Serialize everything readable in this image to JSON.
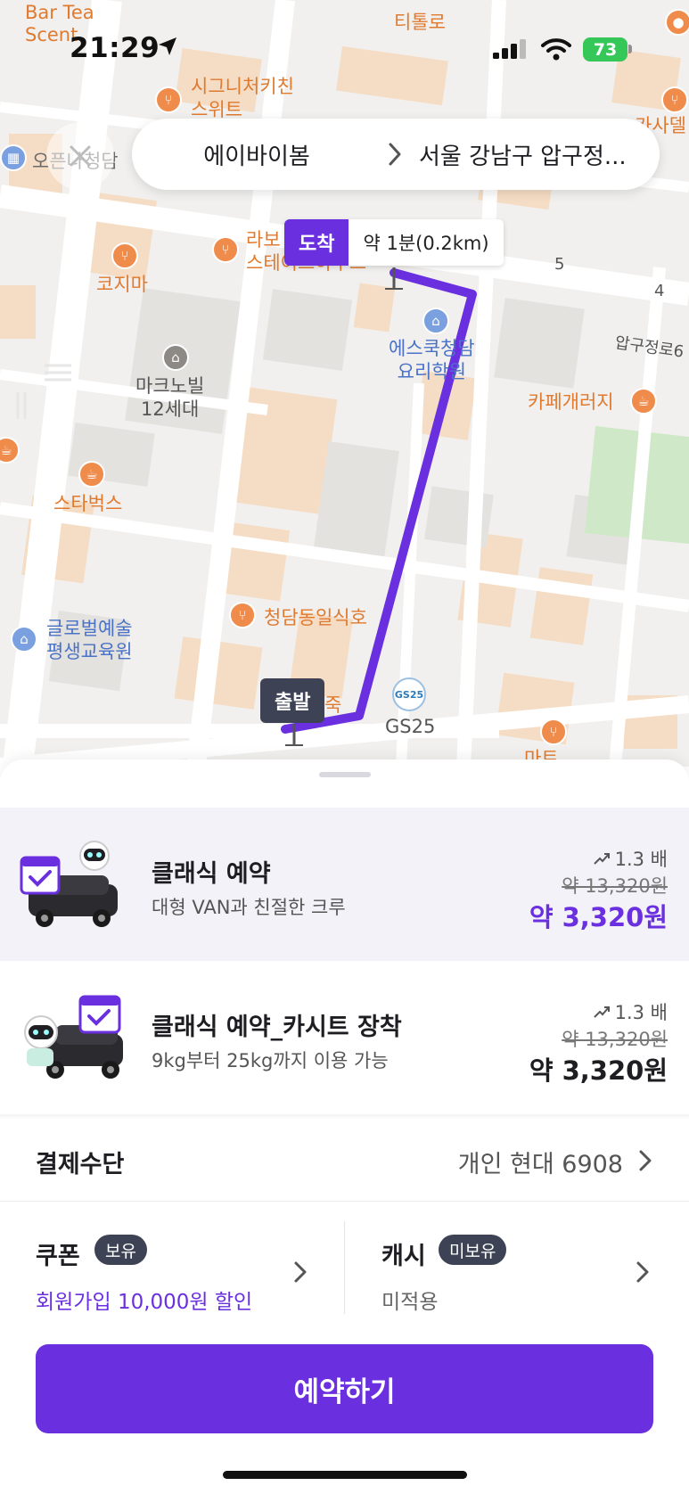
{
  "status_bar": {
    "time": "21:29",
    "battery": "73"
  },
  "map": {
    "labels": {
      "bar_tea_1": "Bar Tea",
      "bar_tea_2": "Scent",
      "teotollo": "티톨로",
      "signature_1": "시그니처키친",
      "signature_2": "스위트",
      "kasadel": "카사델",
      "opennet": "오픈나청담",
      "kojima": "코지마",
      "rabo_1": "라보",
      "rabo_2": "스테이크하우스",
      "num5": "5",
      "num4": "4",
      "apgujeong_ro": "압구정로6",
      "mark_1": "마크노빌",
      "mark_2": "12세대",
      "escook_1": "에스쿡청담",
      "escook_2": "요리학원",
      "cafe_gallery": "카페개러지",
      "starbucks": "스타벅스",
      "global_1": "글로벌예술",
      "global_2": "평생교육원",
      "cheongdam_il": "청담동일식호",
      "gs25": "GS25",
      "gs25_logo_1": "GS",
      "gs25_logo_2": "25",
      "juk": "죽",
      "mart": "마트"
    },
    "arrival": {
      "badge": "도착",
      "eta": "약 1분(0.2km)"
    },
    "departure": {
      "badge": "출발"
    },
    "route_color": "#6a2fdf"
  },
  "route_bar": {
    "origin": "에이바이봄",
    "destination": "서울 강남구 압구정..."
  },
  "services": [
    {
      "title": "클래식 예약",
      "description": "대형 VAN과 친절한 크루",
      "surge": "1.3 배",
      "original_price": "약 13,320원",
      "price": "약 3,320원",
      "selected": true
    },
    {
      "title": "클래식 예약_카시트 장착",
      "description": "9kg부터 25kg까지 이용 가능",
      "surge": "1.3 배",
      "original_price": "약 13,320원",
      "price": "약 3,320원",
      "selected": false
    }
  ],
  "payment": {
    "label": "결제수단",
    "value": "개인 현대 6908"
  },
  "coupon": {
    "label": "쿠폰",
    "badge": "보유",
    "sub": "회원가입 10,000원 할인"
  },
  "cash": {
    "label": "캐시",
    "badge": "미보유",
    "sub": "미적용"
  },
  "cta": {
    "label": "예약하기"
  },
  "colors": {
    "accent": "#6a2fdf",
    "badge_dark": "#3d4255",
    "selected_bg": "#f3f2f8",
    "battery": "#36c759"
  }
}
